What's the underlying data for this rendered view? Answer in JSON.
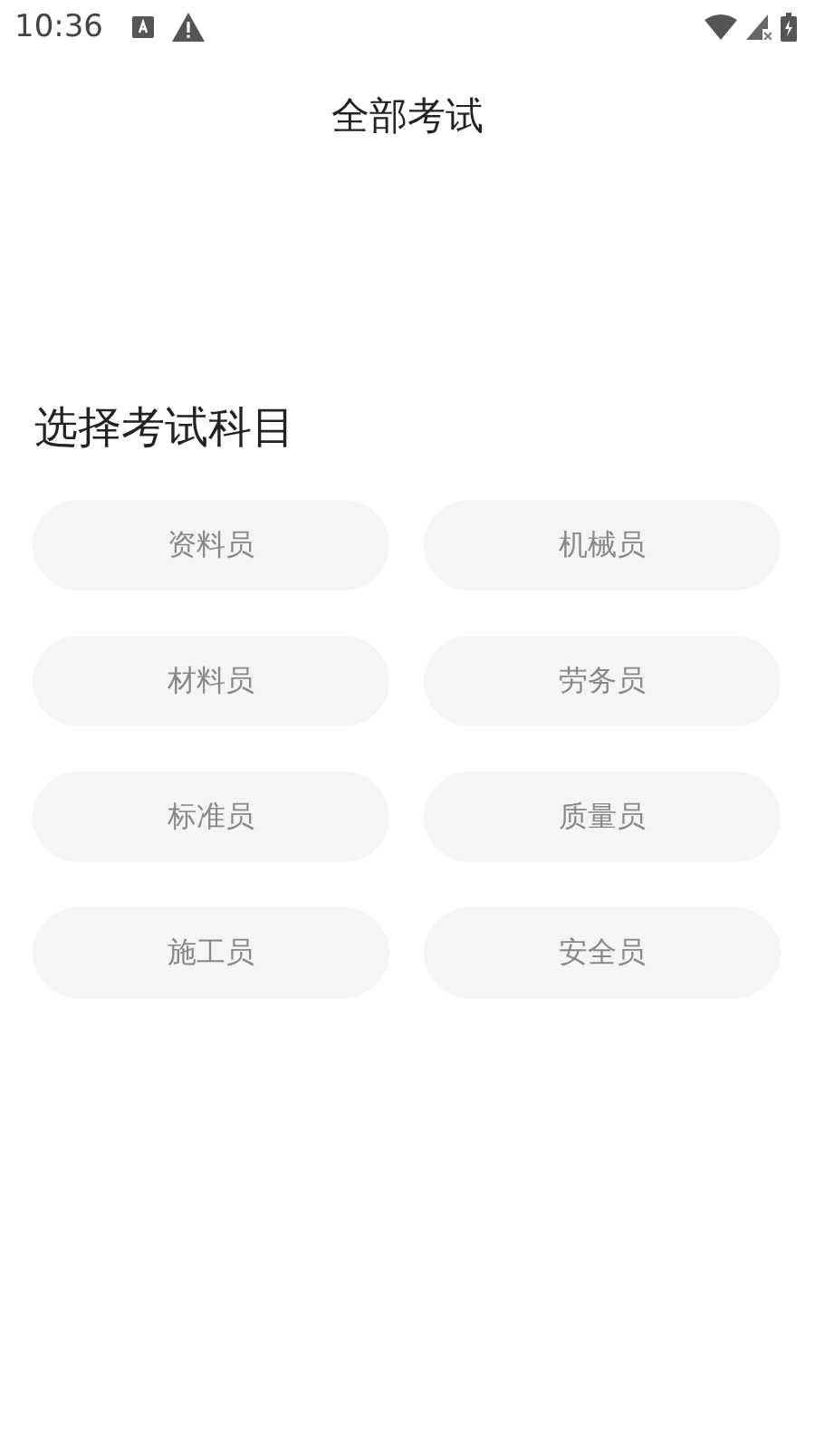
{
  "status_bar": {
    "time": "10:36"
  },
  "header": {
    "title": "全部考试"
  },
  "section": {
    "title": "选择考试科目"
  },
  "subjects": [
    {
      "label": "资料员"
    },
    {
      "label": "机械员"
    },
    {
      "label": "材料员"
    },
    {
      "label": "劳务员"
    },
    {
      "label": "标准员"
    },
    {
      "label": "质量员"
    },
    {
      "label": "施工员"
    },
    {
      "label": "安全员"
    }
  ]
}
